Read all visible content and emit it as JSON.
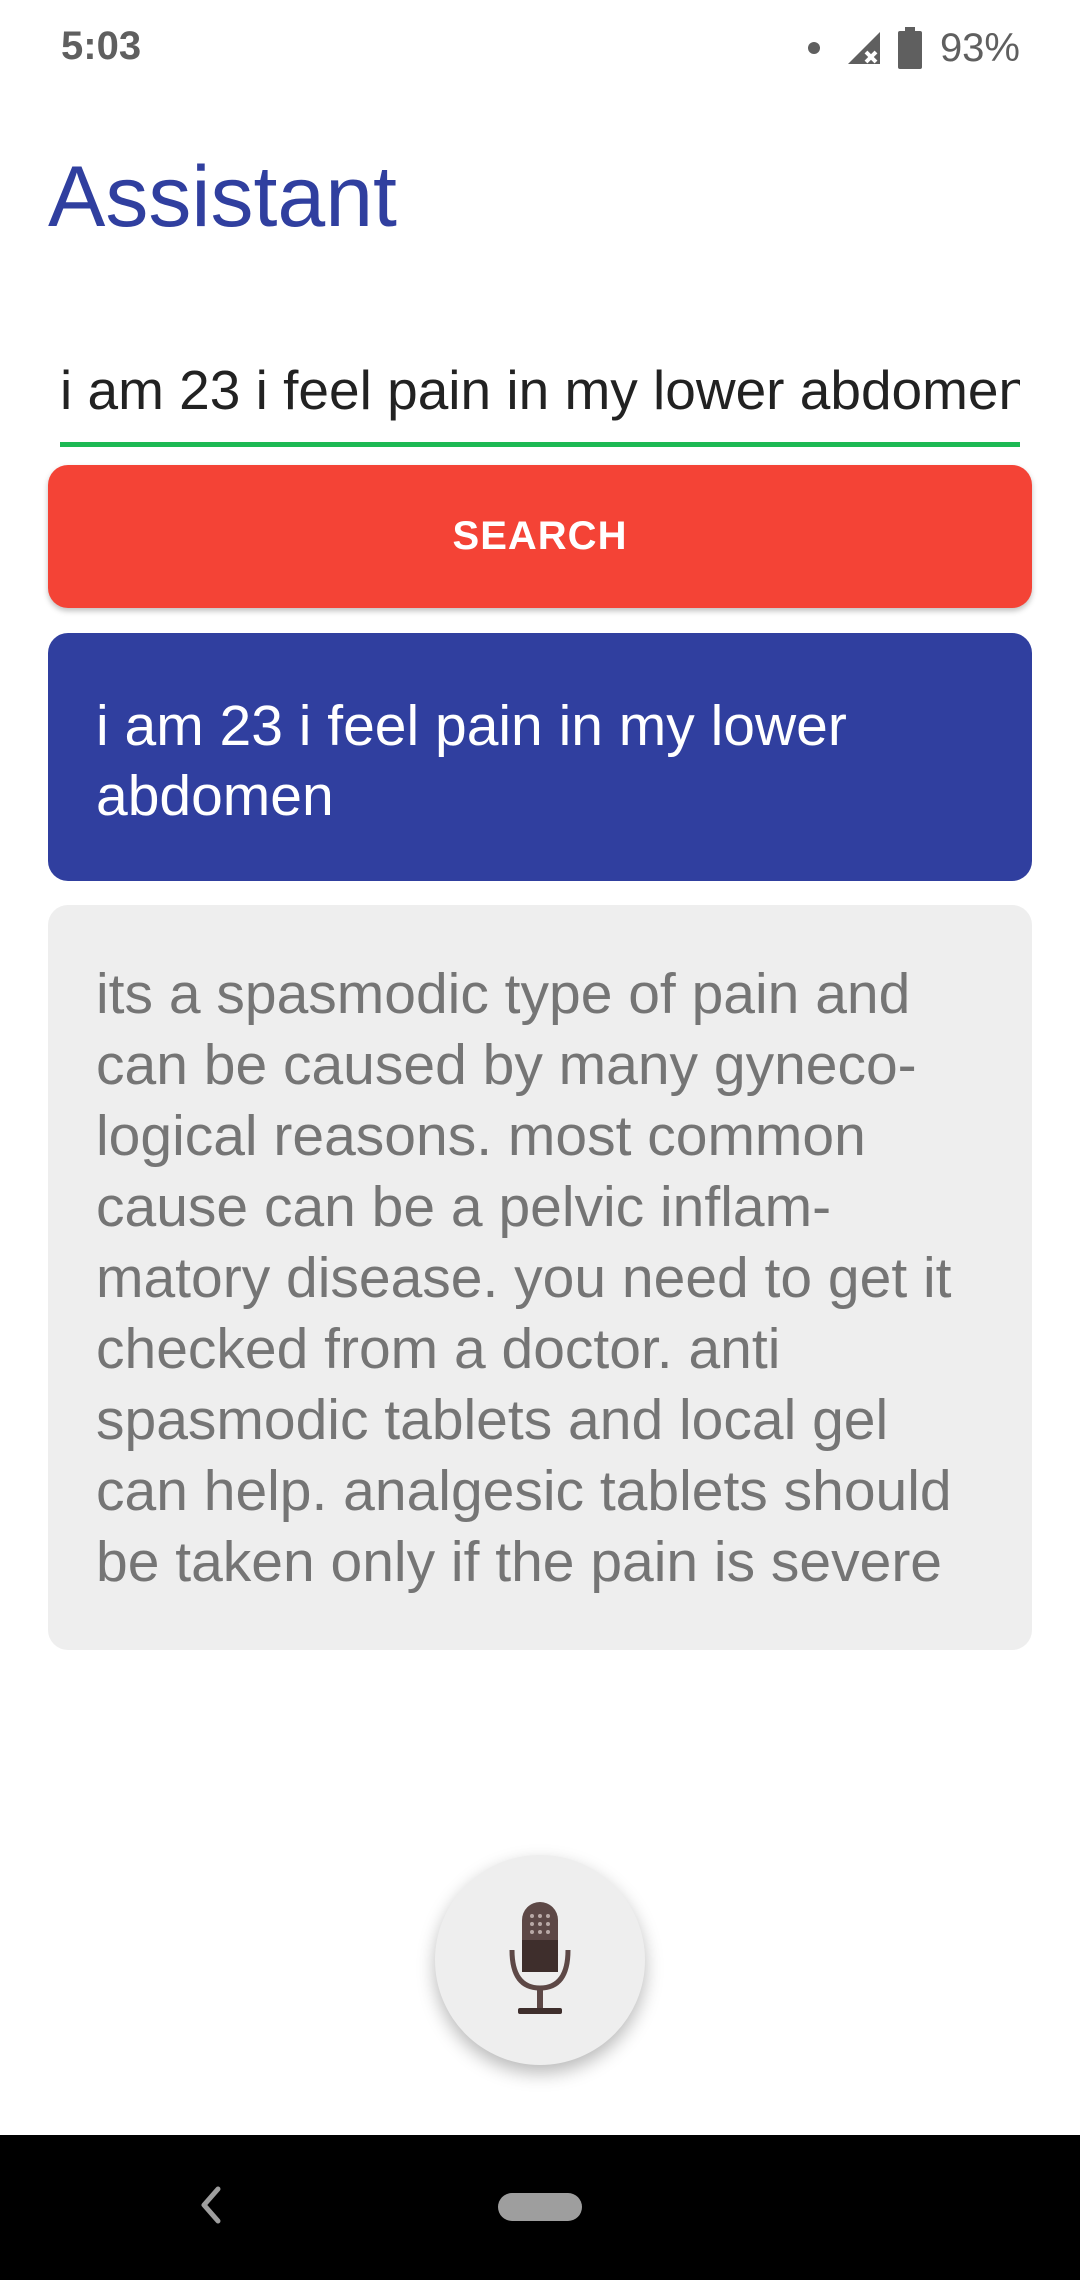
{
  "status_bar": {
    "time": "5:03",
    "battery": "93%",
    "icons": [
      "notification-dot-icon",
      "signal-no-data-icon",
      "battery-icon"
    ]
  },
  "app": {
    "title": "Assistant"
  },
  "query": {
    "value": "i am 23 i feel pain in my lower abdomen"
  },
  "search_button": {
    "label": "SEARCH"
  },
  "conversation": {
    "user_message": "i am 23 i feel pain in my lower abdomen",
    "assistant_reply": "its a spasmodic type of pain and can be caused by many gyneco-logical reasons. most common cause can be a pelvic inflam-matory disease. you need to get it checked from a doctor. anti spasmodic tablets and local gel can help. analgesic tablets should be taken only if the pain is severe"
  },
  "mic_button": {
    "icon": "microphone-icon"
  },
  "navigation": {
    "icons": [
      "back-icon",
      "home-pill-icon"
    ]
  },
  "colors": {
    "title": "#303f9f",
    "search_button": "#f44336",
    "user_bubble": "#303f9f",
    "answer_bubble": "#eeeeee",
    "input_underline": "#1db954"
  }
}
